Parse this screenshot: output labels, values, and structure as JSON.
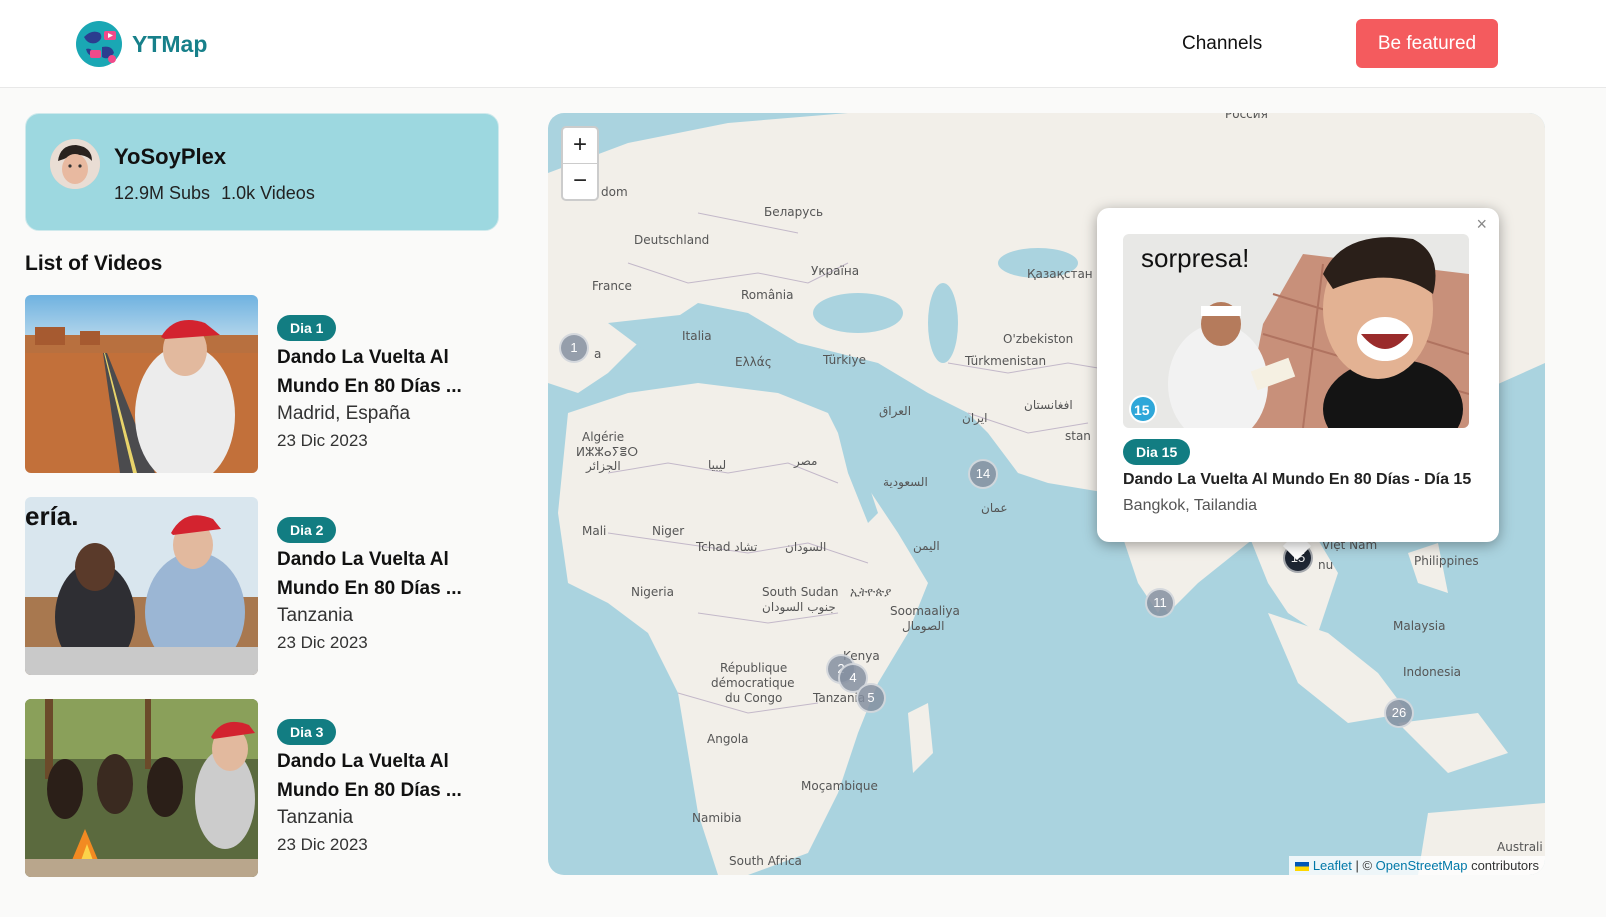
{
  "header": {
    "brand": "YTMap",
    "nav_channels": "Channels",
    "featured_button": "Be featured"
  },
  "channel": {
    "name": "YoSoyPlex",
    "subs": "12.9M Subs",
    "videos": "1.0k Videos"
  },
  "list_title": "List of Videos",
  "videos": [
    {
      "badge": "Dia 1",
      "title": "Dando La Vuelta Al Mundo En 80 Días ...",
      "location": "Madrid, España",
      "date": "23 Dic 2023"
    },
    {
      "badge": "Dia 2",
      "title": "Dando La Vuelta Al Mundo En 80 Días ...",
      "location": "Tanzania",
      "date": "23 Dic 2023",
      "thumb_caption": "ería."
    },
    {
      "badge": "Dia 3",
      "title": "Dando La Vuelta Al Mundo En 80 Días ...",
      "location": "Tanzania",
      "date": "23 Dic 2023"
    }
  ],
  "map": {
    "zoom_in": "+",
    "zoom_out": "−",
    "labels": [
      "Россия",
      "dom",
      "Беларусь",
      "Deutschland",
      "Україна",
      "France",
      "România",
      "Қазақстан",
      "Italia",
      "O'zbekiston",
      "Ελλάς",
      "Türkiye",
      "Türkmenistan",
      "a",
      "العراق",
      "ایران",
      "افغانستان",
      "Algérie",
      "ⵍⵣⵣⴰⵢⴻⵔ",
      "الجزائر",
      "ليبيا",
      "مصر",
      "السعودية",
      "عمان",
      "Mali",
      "Niger",
      "Tchad تشاد",
      "السودان",
      "اليمن",
      "Nigeria",
      "South Sudan",
      "ኢትዮጵያ",
      "جنوب السودان",
      "Soomaaliya",
      "الصومال",
      "République",
      "démocratique",
      "du Congo",
      "Kenya",
      "Tanzania",
      "Angola",
      "Moçambique",
      "Namibia",
      "South Africa",
      "Philippines",
      "Malaysia",
      "Indonesia",
      "Australi",
      "Việt Nam",
      "nu",
      "stan"
    ],
    "clusters": [
      "1",
      "14",
      "15",
      "11",
      "2",
      "4",
      "5",
      "26"
    ],
    "attribution_leaflet": "Leaflet",
    "attribution_sep": " | © ",
    "attribution_osm": "OpenStreetMap",
    "attribution_suffix": " contributors"
  },
  "popup": {
    "image_caption": "sorpresa!",
    "image_badge": "15",
    "badge": "Dia 15",
    "title": "Dando La Vuelta Al Mundo En 80 Días - Día 15",
    "location": "Bangkok, Tailandia",
    "close": "×"
  }
}
